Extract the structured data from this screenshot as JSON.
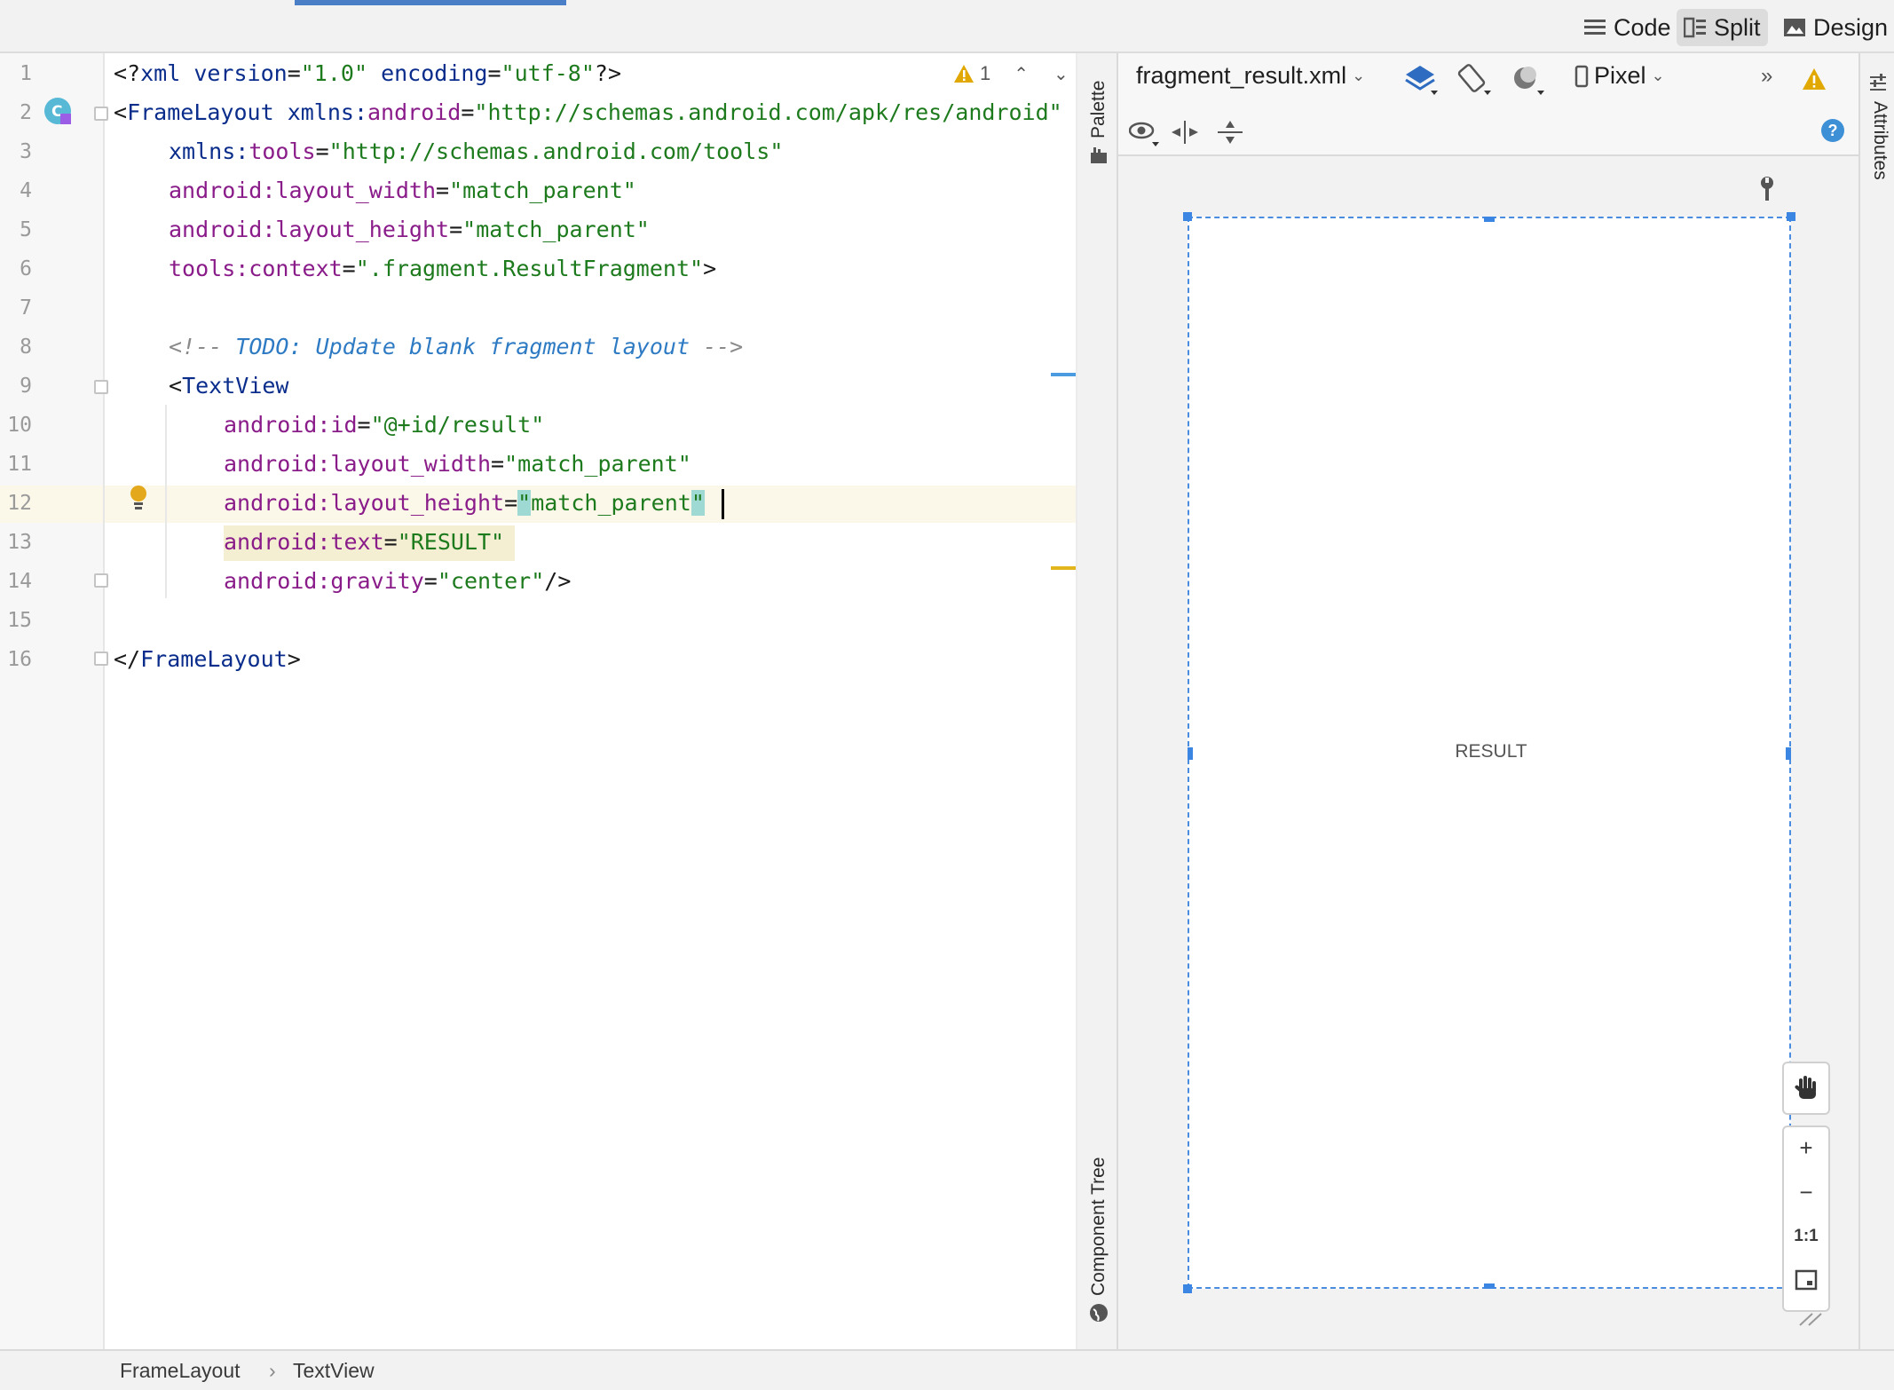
{
  "view_modes": {
    "code": "Code",
    "split": "Split",
    "design": "Design",
    "active": "Split"
  },
  "editor": {
    "warning_count": "1",
    "line_numbers": [
      "1",
      "2",
      "3",
      "4",
      "5",
      "6",
      "7",
      "8",
      "9",
      "10",
      "11",
      "12",
      "13",
      "14",
      "15",
      "16"
    ],
    "lines": {
      "l1": {
        "a": "<?",
        "b": "xml ",
        "c": "version",
        "d": "=",
        "e": "\"1.0\"",
        "f": " encoding",
        "g": "=",
        "h": "\"utf-8\"",
        "i": "?>"
      },
      "l2": {
        "a": "<",
        "b": "FrameLayout",
        "c": " xmlns:",
        "d": "android",
        "e": "=",
        "f": "\"http://schemas.android.com/apk/res/android\""
      },
      "l3": {
        "a": "xmlns:",
        "b": "tools",
        "c": "=",
        "d": "\"http://schemas.android.com/tools\""
      },
      "l4": {
        "a": "android:layout_width",
        "b": "=",
        "c": "\"match_parent\""
      },
      "l5": {
        "a": "android:layout_height",
        "b": "=",
        "c": "\"match_parent\""
      },
      "l6": {
        "a": "tools:context",
        "b": "=",
        "c": "\".fragment.ResultFragment\"",
        "d": ">"
      },
      "l8": {
        "a": "<!-- ",
        "b": "TODO: Update blank fragment layout",
        "c": " -->"
      },
      "l9": {
        "a": "<",
        "b": "TextView"
      },
      "l10": {
        "a": "android:id",
        "b": "=",
        "c": "\"@+id/result\""
      },
      "l11": {
        "a": "android:layout_width",
        "b": "=",
        "c": "\"match_parent\""
      },
      "l12": {
        "a": "android:layout_height",
        "b": "=",
        "c": "\"",
        "d": "match_parent",
        "e": "\""
      },
      "l13": {
        "a": "android:text",
        "b": "=",
        "c": "\"RESULT\""
      },
      "l14": {
        "a": "android:gravity",
        "b": "=",
        "c": "\"center\"",
        "d": "/>"
      },
      "l16": {
        "a": "</",
        "b": "FrameLayout",
        "c": ">"
      }
    }
  },
  "side_panels": {
    "palette": "Palette",
    "component_tree": "Component Tree",
    "attributes": "Attributes"
  },
  "design": {
    "file_name": "fragment_result.xml",
    "device": "Pixel",
    "preview_text": "RESULT",
    "zoom_one_to_one": "1:1",
    "zoom_in": "+",
    "zoom_out": "−"
  },
  "breadcrumb": {
    "root": "FrameLayout",
    "separator": "›",
    "leaf": "TextView"
  },
  "colors": {
    "accent": "#4a7ec7",
    "selection": "#3c86e3",
    "warning": "#e0a800",
    "help": "#3d8fd6"
  }
}
